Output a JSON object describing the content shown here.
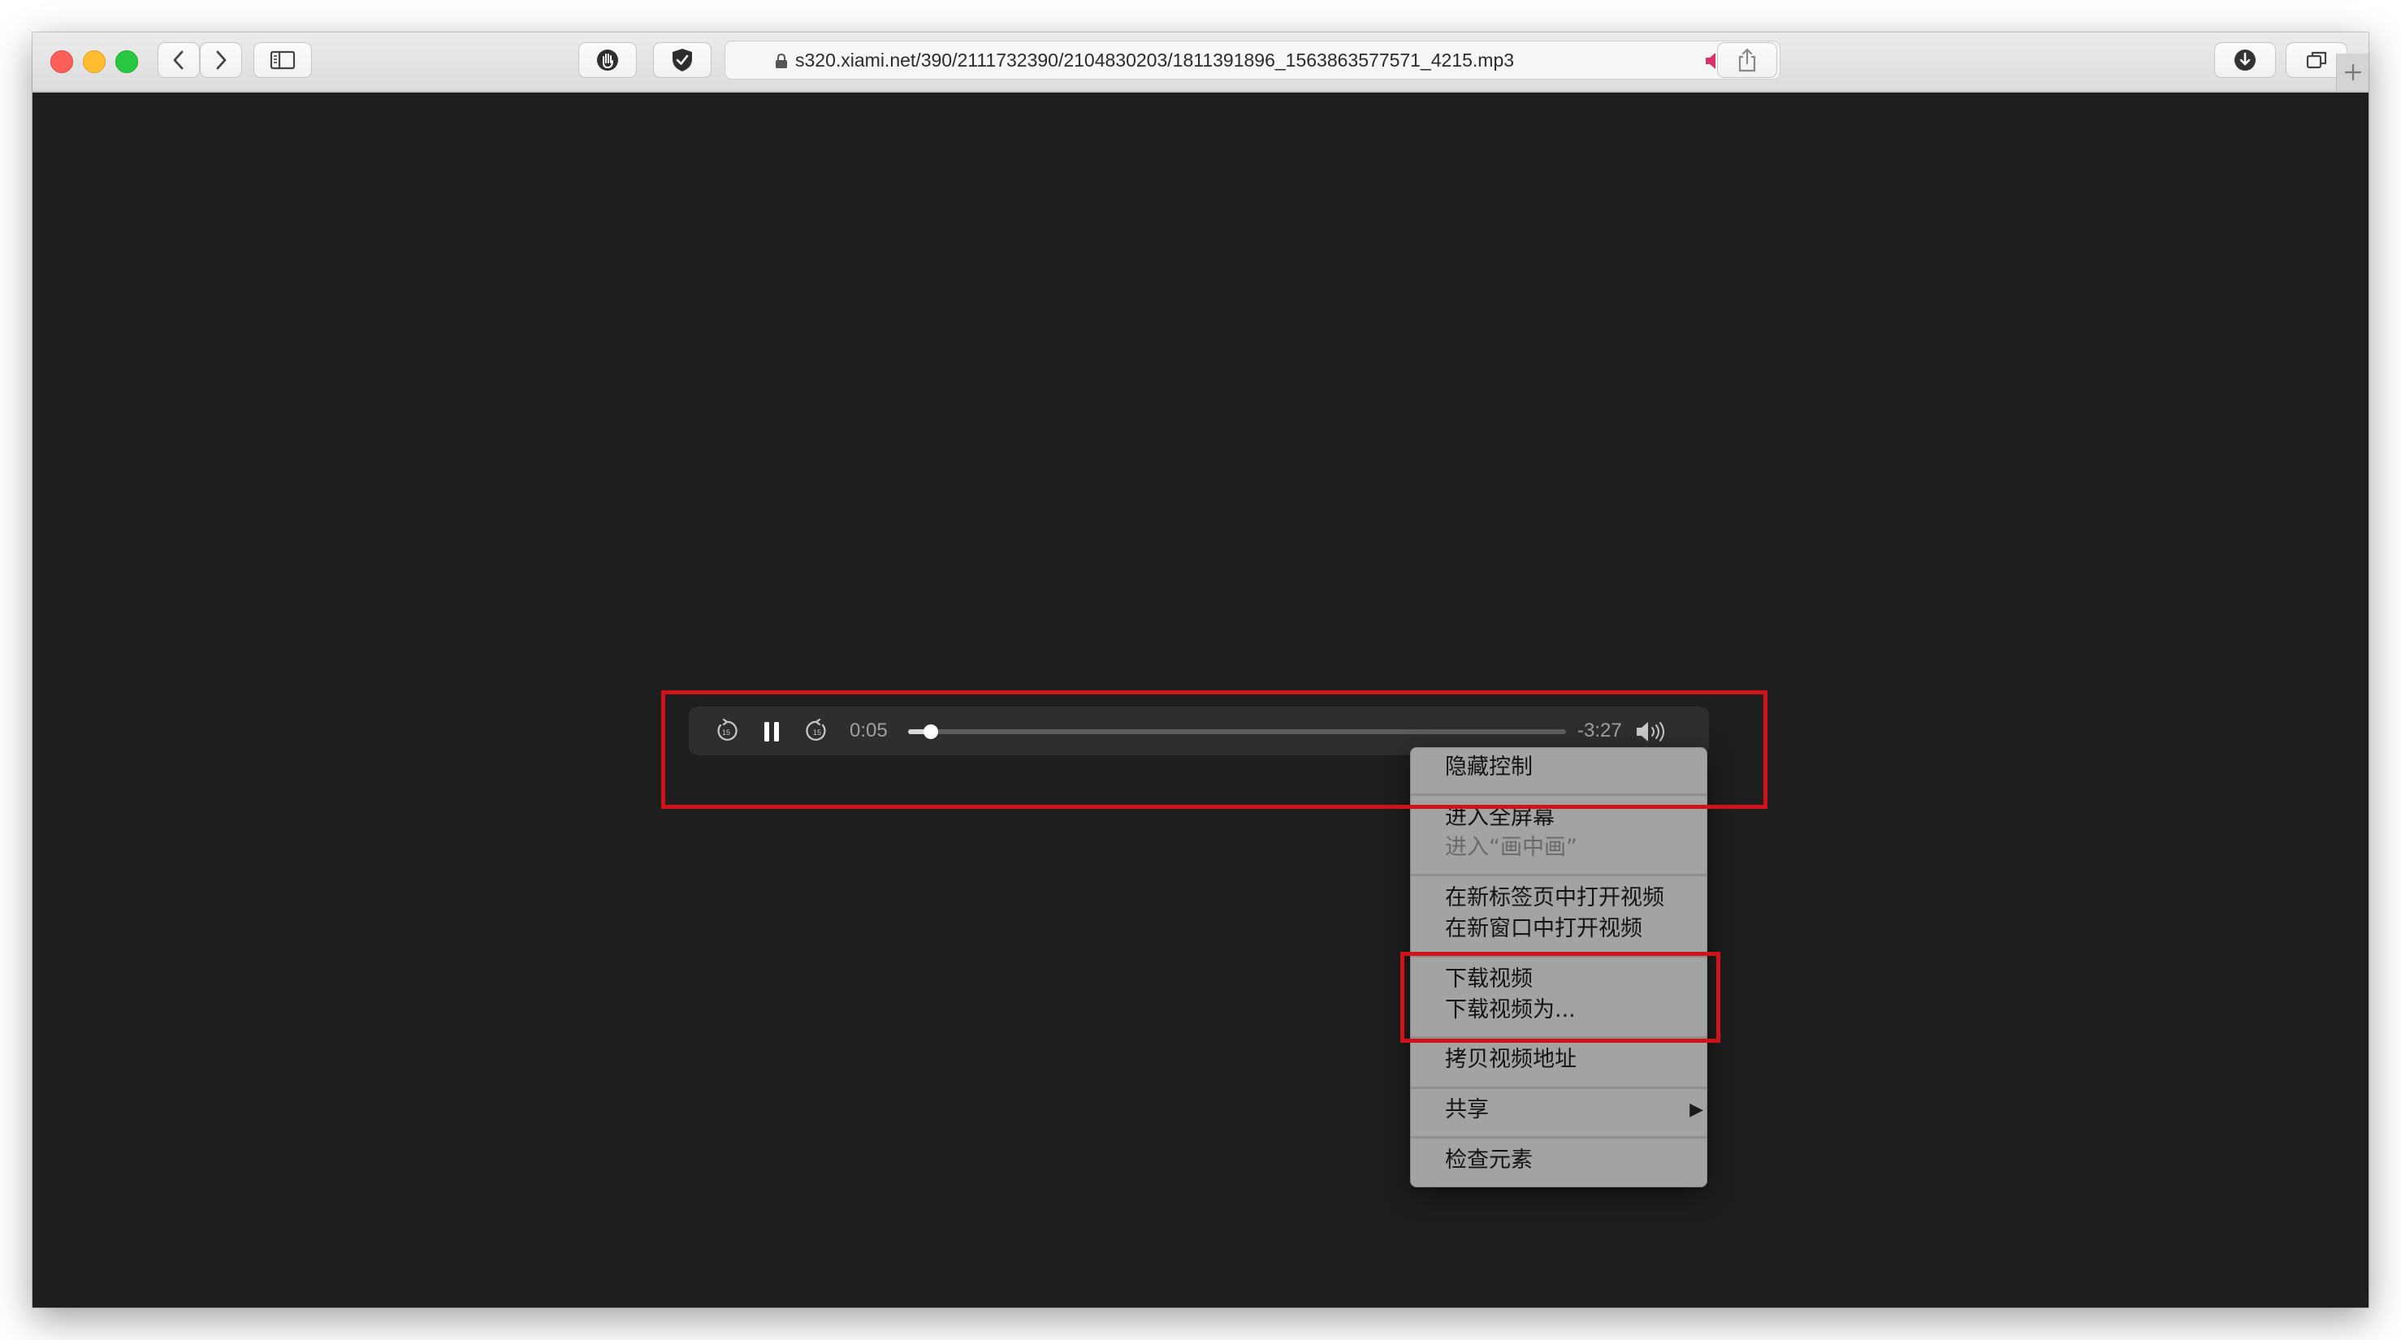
{
  "browser": {
    "url": "s320.xiami.net/390/2111732390/2104830203/1811391896_1563863577571_4215.mp3"
  },
  "player": {
    "elapsed": "0:05",
    "remaining": "-3:27",
    "progress": 0.035
  },
  "context_menu": {
    "items": [
      {
        "label": "隐藏控制",
        "enabled": true
      },
      {
        "label": "进入全屏幕",
        "enabled": true
      },
      {
        "label": "进入“画中画”",
        "enabled": false
      },
      {
        "label": "在新标签页中打开视频",
        "enabled": true
      },
      {
        "label": "在新窗口中打开视频",
        "enabled": true
      },
      {
        "label": "下载视频",
        "enabled": true
      },
      {
        "label": "下载视频为...",
        "enabled": true
      },
      {
        "label": "拷贝视频地址",
        "enabled": true
      },
      {
        "label": "共享",
        "enabled": true,
        "submenu_arrow": "▶"
      },
      {
        "label": "检查元素",
        "enabled": true
      }
    ]
  },
  "icons": {
    "back": "chevron-left-icon",
    "forward": "chevron-right-icon",
    "sidebar": "sidebar-icon",
    "privacy": "hand-icon",
    "shield": "shield-check-icon",
    "lock": "lock-icon",
    "audio": "speaker-playing-icon",
    "reload": "reload-icon",
    "share": "share-icon",
    "downloads": "download-icon",
    "tabs": "tab-overview-icon",
    "new_tab": "plus-icon",
    "skip_back": "skip-back-15-icon",
    "pause": "pause-icon",
    "skip_forward": "skip-forward-15-icon",
    "volume": "volume-icon"
  },
  "colors": {
    "annotation_red": "#d0121b",
    "page_background": "#1e1e1e",
    "audio_indicator": "#d6336c"
  }
}
